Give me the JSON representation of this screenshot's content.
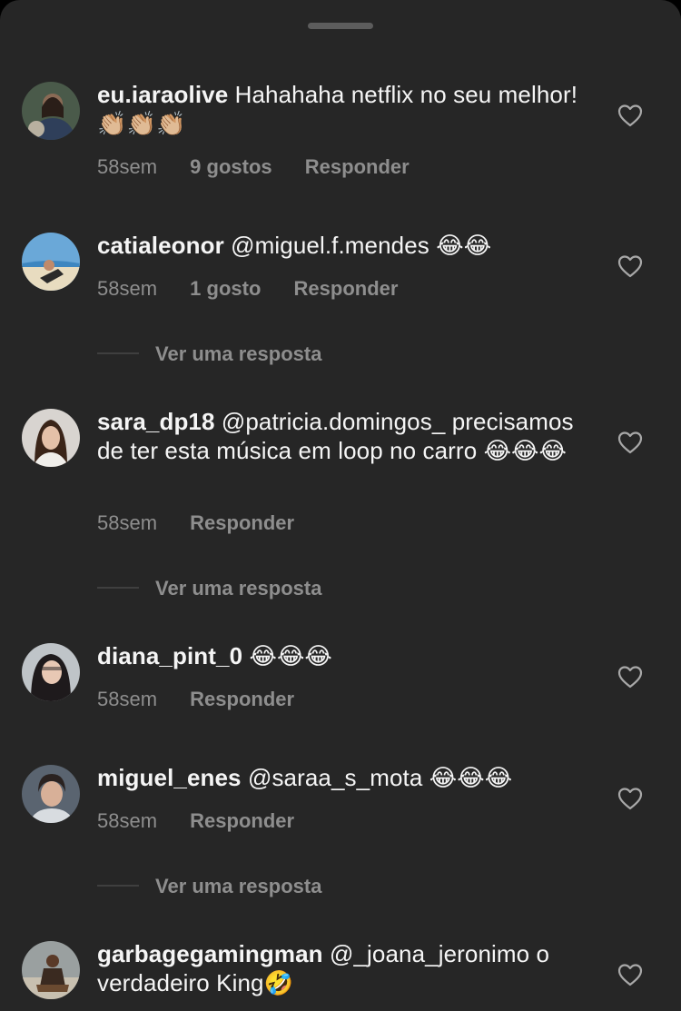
{
  "comments": [
    {
      "username": "eu.iaraolive",
      "text": "Hahahaha netflix no seu melhor! 👏🏼👏🏼👏🏼",
      "time": "58sem",
      "likes": "9 gostos",
      "reply": "Responder"
    },
    {
      "username": "catialeonor",
      "text": "@miguel.f.mendes 😂😂",
      "time": "58sem",
      "likes": "1 gosto",
      "reply": "Responder",
      "view_replies": "Ver uma resposta"
    },
    {
      "username": "sara_dp18",
      "text": "@patricia.domingos_ precisamos de ter esta música em loop no carro 😂😂😂",
      "time": "58sem",
      "reply": "Responder",
      "view_replies": "Ver uma resposta"
    },
    {
      "username": "diana_pint_0",
      "text": "😂😂😂",
      "time": "58sem",
      "reply": "Responder"
    },
    {
      "username": "miguel_enes",
      "text": "@saraa_s_mota 😂😂😂",
      "time": "58sem",
      "reply": "Responder",
      "view_replies": "Ver uma resposta"
    },
    {
      "username": "garbagegamingman",
      "text": "@_joana_jeronimo o verdadeiro King🤣"
    }
  ],
  "colors": {
    "background": "#262626",
    "primary_text": "#f5f5f5",
    "secondary_text": "#8e8e8e"
  },
  "icons": {
    "like": "heart-outline-icon",
    "drag": "grabber-handle"
  }
}
